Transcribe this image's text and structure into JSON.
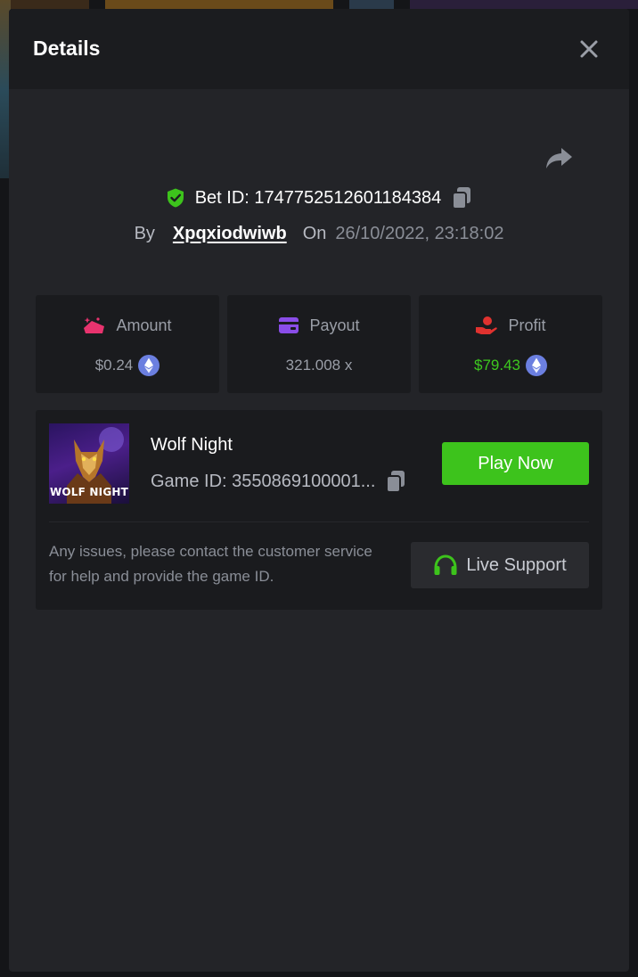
{
  "modal": {
    "title": "Details"
  },
  "bet": {
    "id_text": "Bet ID: 1747752512601184384",
    "by_label": "By",
    "username": "Xpqxiodwiwb",
    "on_label": "On",
    "datetime": "26/10/2022, 23:18:02"
  },
  "stats": [
    {
      "label": "Amount",
      "value": "$0.24",
      "icon": "amount-icon",
      "accent": "#e8336e",
      "currency_icon": "eth-icon"
    },
    {
      "label": "Payout",
      "value": "321.008 x",
      "icon": "wallet-icon",
      "accent": "#8a4de8"
    },
    {
      "label": "Profit",
      "value": "$79.43",
      "icon": "profit-hand-icon",
      "accent": "#e0322f",
      "currency_icon": "eth-icon",
      "value_color": "#3dc91f"
    }
  ],
  "game": {
    "thumbnail_title": "WOLF NIGHT",
    "name": "Wolf Night",
    "id_text": "Game ID: 3550869100001...",
    "play_label": "Play Now"
  },
  "support": {
    "help_text": "Any issues, please contact the customer service for help and provide the game ID.",
    "button_label": "Live Support"
  },
  "colors": {
    "primary_green": "#3dc31c",
    "shield_green": "#3dc31c",
    "modal_bg": "#232428",
    "card_bg": "#1a1b1e",
    "eth": "#6b7fe0"
  }
}
